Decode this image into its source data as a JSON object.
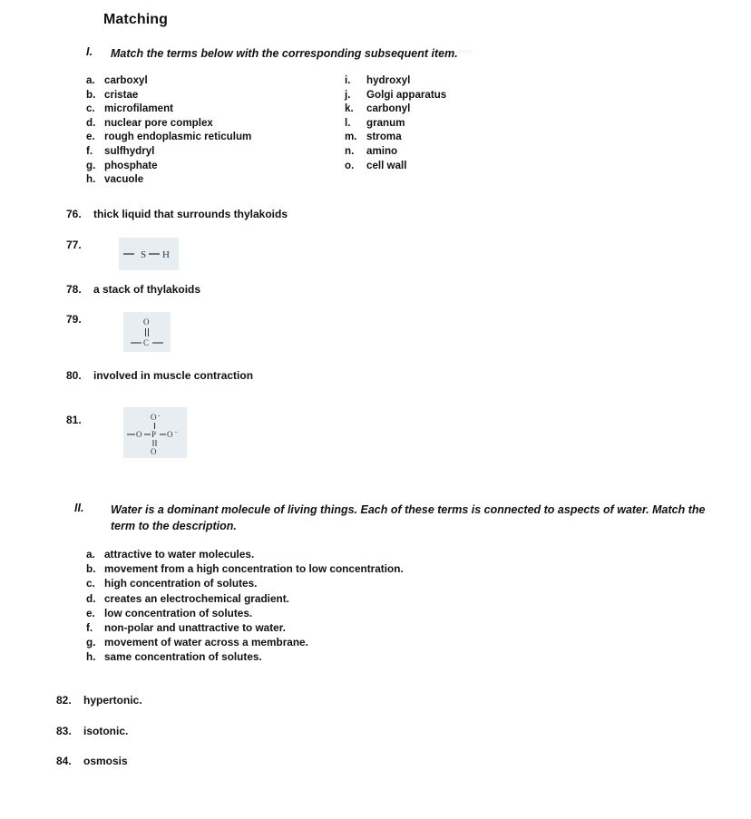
{
  "document": {
    "title": "Matching"
  },
  "section_one": {
    "numeral": "I.",
    "instruction": "Match the terms below with the corresponding subsequent item.",
    "terms_left": [
      {
        "letter": "a.",
        "label": "carboxyl"
      },
      {
        "letter": "b.",
        "label": "cristae"
      },
      {
        "letter": "c.",
        "label": "microfilament"
      },
      {
        "letter": "d.",
        "label": "nuclear pore complex"
      },
      {
        "letter": "e.",
        "label": "rough endoplasmic reticulum"
      },
      {
        "letter": "f.",
        "label": "sulfhydryl"
      },
      {
        "letter": "g.",
        "label": "phosphate"
      },
      {
        "letter": "h.",
        "label": "vacuole"
      }
    ],
    "terms_right": [
      {
        "letter": "i.",
        "label": "hydroxyl"
      },
      {
        "letter": "j.",
        "label": "Golgi apparatus"
      },
      {
        "letter": "k.",
        "label": "carbonyl"
      },
      {
        "letter": "l.",
        "label": "granum"
      },
      {
        "letter": "m.",
        "label": "stroma"
      },
      {
        "letter": "n.",
        "label": "amino"
      },
      {
        "letter": "o.",
        "label": "cell wall"
      }
    ],
    "questions": [
      {
        "number": "76.",
        "text": "thick liquid that surrounds thylakoids",
        "kind": "text"
      },
      {
        "number": "77.",
        "text": "",
        "kind": "structure",
        "structure": "sulfhydryl",
        "atoms": [
          "S",
          "H"
        ]
      },
      {
        "number": "78.",
        "text": "a stack of thylakoids",
        "kind": "text"
      },
      {
        "number": "79.",
        "text": "",
        "kind": "structure",
        "structure": "carbonyl",
        "atoms": [
          "O",
          "C"
        ]
      },
      {
        "number": "80.",
        "text": "involved in muscle contraction",
        "kind": "text"
      },
      {
        "number": "81.",
        "text": "",
        "kind": "structure",
        "structure": "phosphate",
        "atoms": [
          "O",
          "O",
          "P",
          "O",
          "O"
        ]
      }
    ]
  },
  "section_two": {
    "numeral": "II.",
    "instruction_line1": "Water is a dominant molecule of living things. Each of these terms is connected to aspects of water. Match the",
    "instruction_line2": "term to the description.",
    "descriptions": [
      {
        "letter": "a.",
        "label": "attractive to water molecules."
      },
      {
        "letter": "b.",
        "label": "movement from a high concentration to low concentration."
      },
      {
        "letter": "c.",
        "label": "high concentration of solutes."
      },
      {
        "letter": "d.",
        "label": "creates an electrochemical gradient."
      },
      {
        "letter": "e.",
        "label": "low concentration of solutes."
      },
      {
        "letter": "f.",
        "label": "non-polar and unattractive to water."
      },
      {
        "letter": "g.",
        "label": "movement of water across a membrane."
      },
      {
        "letter": "h.",
        "label": "same concentration of solutes."
      }
    ],
    "questions": [
      {
        "number": "82.",
        "text": "hypertonic."
      },
      {
        "number": "83.",
        "text": "isotonic."
      },
      {
        "number": "84.",
        "text": "osmosis"
      }
    ]
  },
  "colors": {
    "page_background": "#ffffff",
    "text": "#111111",
    "structure_box_background": "#e8edf1",
    "structure_ink": "#2b3a44"
  }
}
